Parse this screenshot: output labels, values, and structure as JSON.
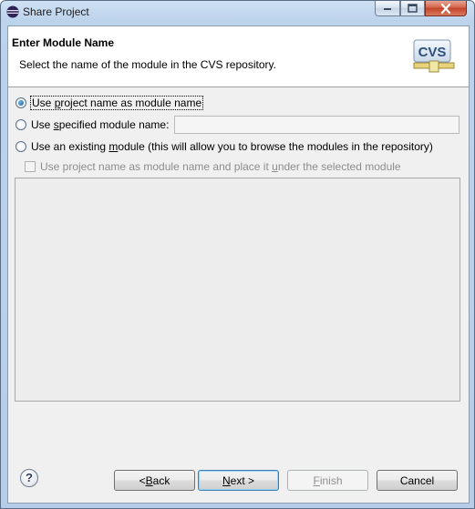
{
  "window": {
    "title": "Share Project"
  },
  "header": {
    "title": "Enter Module Name",
    "description": "Select the name of the module in the CVS repository.",
    "logo_text": "CVS"
  },
  "options": {
    "use_project_name": {
      "pre": "Use ",
      "mnemonic": "p",
      "post": "roject name as module name",
      "selected": true
    },
    "use_specified": {
      "pre": "Use ",
      "mnemonic": "s",
      "post": "pecified module name:",
      "selected": false,
      "value": ""
    },
    "use_existing": {
      "pre": "Use an existing ",
      "mnemonic": "m",
      "post": "odule (this will allow you to browse the modules in the repository)",
      "selected": false
    },
    "place_under": {
      "pre": "Use project name as module name and place it ",
      "mnemonic": "u",
      "post": "nder the selected module",
      "checked": false,
      "enabled": false
    }
  },
  "footer": {
    "help": "?",
    "back": {
      "pre": "< ",
      "mnemonic": "B",
      "post": "ack"
    },
    "next": {
      "pre": "",
      "mnemonic": "N",
      "post": "ext >"
    },
    "finish": {
      "pre": "",
      "mnemonic": "F",
      "post": "inish"
    },
    "cancel": "Cancel"
  },
  "colors": {
    "selected_radio": "#1b5f9e",
    "disabled_text": "#8d8d8d"
  }
}
